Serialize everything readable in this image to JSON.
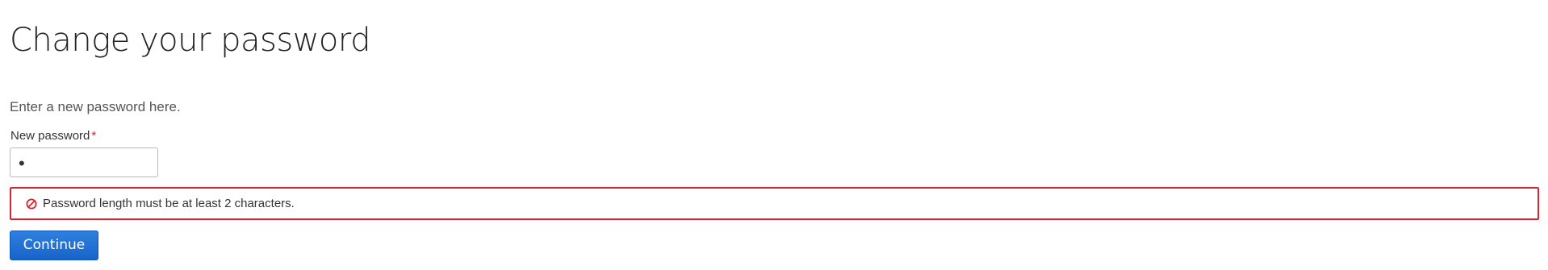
{
  "page": {
    "title": "Change your password",
    "intro": "Enter a new password here."
  },
  "form": {
    "password_label": "New password",
    "required_marker": "*",
    "password_value": "•"
  },
  "error": {
    "icon": "prohibited-icon",
    "message": "Password length must be at least 2 characters."
  },
  "actions": {
    "continue_label": "Continue"
  },
  "colors": {
    "error": "#d9262e",
    "primary_button": "#1764c9"
  }
}
